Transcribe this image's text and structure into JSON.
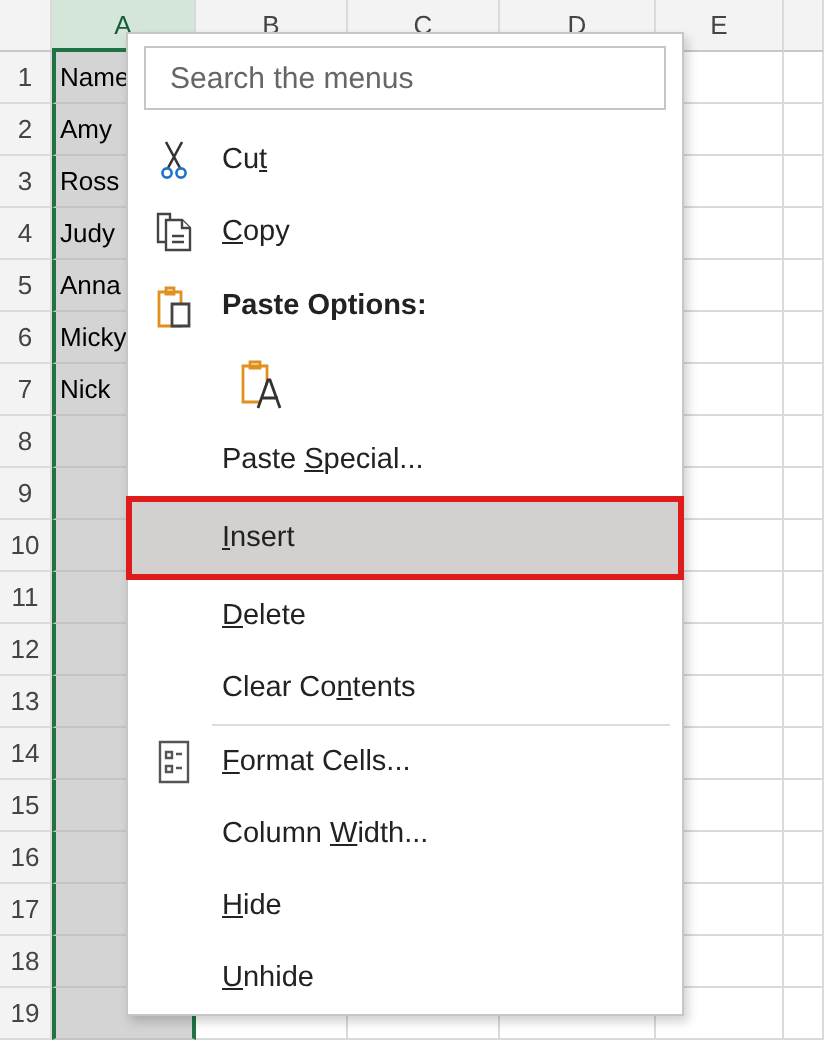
{
  "sheet": {
    "columns": [
      {
        "label": "A",
        "selected": true
      },
      {
        "label": "B",
        "selected": false
      },
      {
        "label": "C",
        "selected": false
      },
      {
        "label": "D",
        "selected": false
      },
      {
        "label": "E",
        "selected": false
      }
    ],
    "rows": [
      {
        "number": "1",
        "cell_a": "Name"
      },
      {
        "number": "2",
        "cell_a": "Amy"
      },
      {
        "number": "3",
        "cell_a": "Ross"
      },
      {
        "number": "4",
        "cell_a": "Judy"
      },
      {
        "number": "5",
        "cell_a": "Anna"
      },
      {
        "number": "6",
        "cell_a": "Micky"
      },
      {
        "number": "7",
        "cell_a": "Nick"
      },
      {
        "number": "8"
      },
      {
        "number": "9"
      },
      {
        "number": "10"
      },
      {
        "number": "11"
      },
      {
        "number": "12"
      },
      {
        "number": "13"
      },
      {
        "number": "14"
      },
      {
        "number": "15"
      },
      {
        "number": "16"
      },
      {
        "number": "17"
      },
      {
        "number": "18"
      },
      {
        "number": "19"
      }
    ]
  },
  "context_menu": {
    "search": {
      "placeholder": "Search the menus"
    },
    "items": [
      {
        "kind": "cut",
        "before": "Cu",
        "key": "t",
        "selected": false
      },
      {
        "kind": "copy",
        "key": "C",
        "after": "opy",
        "selected": false
      },
      {
        "kind": "heading",
        "text": "Paste Options:"
      },
      {
        "kind": "pasteoption"
      },
      {
        "kind": "command",
        "before": "Paste ",
        "key": "S",
        "after": "pecial...",
        "selected": false
      },
      {
        "kind": "command",
        "key": "I",
        "after": "nsert",
        "selected": true,
        "outlined": true
      },
      {
        "kind": "command",
        "key": "D",
        "after": "elete",
        "selected": false
      },
      {
        "kind": "command",
        "before": "Clear Co",
        "key": "n",
        "after": "tents",
        "selected": false
      },
      {
        "kind": "separator"
      },
      {
        "kind": "formatcells",
        "key": "F",
        "after": "ormat Cells...",
        "selected": false
      },
      {
        "kind": "command",
        "before": "Column ",
        "key": "W",
        "after": "idth...",
        "selected": false
      },
      {
        "kind": "command",
        "key": "H",
        "after": "ide",
        "selected": false
      },
      {
        "kind": "command",
        "key": "U",
        "after": "nhide",
        "selected": false
      }
    ]
  }
}
